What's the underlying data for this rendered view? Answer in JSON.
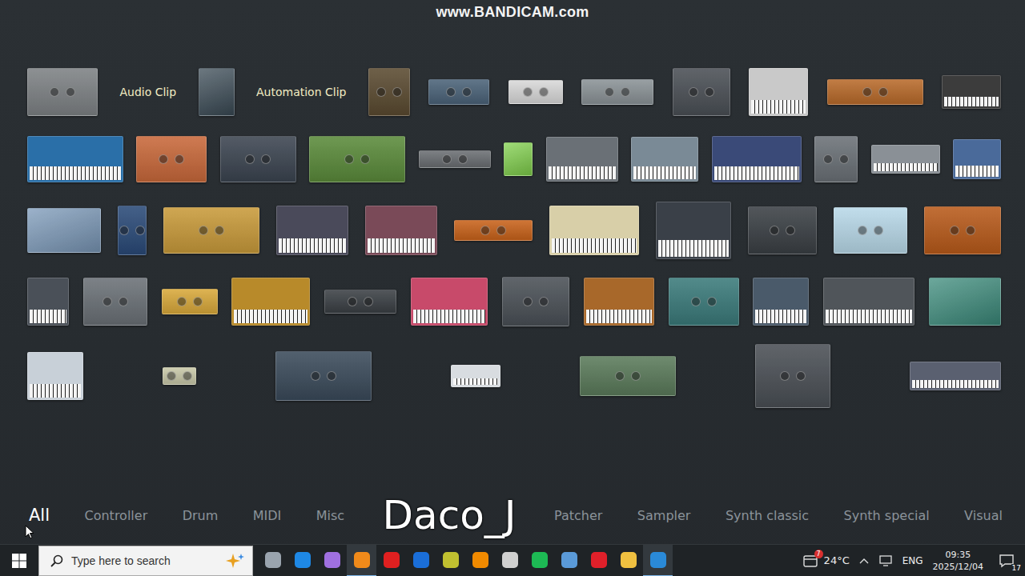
{
  "watermark": "www.BANDICAM.com",
  "caption": "Daco_J",
  "picker": {
    "rows": [
      [
        {
          "kind": "panel",
          "color": "#7d8184"
        },
        {
          "kind": "label",
          "text": "Audio Clip"
        },
        {
          "kind": "photo",
          "color": "#3a4a55"
        },
        {
          "kind": "label",
          "text": "Automation Clip"
        },
        {
          "kind": "panel",
          "color": "#5a4a30"
        },
        {
          "kind": "panel",
          "color": "#4a6278"
        },
        {
          "kind": "panel",
          "color": "#d8d8d8"
        },
        {
          "kind": "panel",
          "color": "#8a9296"
        },
        {
          "kind": "panel",
          "color": "#4a4f55"
        },
        {
          "kind": "keys",
          "color": "#c9c9c9"
        },
        {
          "kind": "panel",
          "color": "#b86a2a"
        },
        {
          "kind": "keys",
          "color": "#3c3c3c"
        }
      ],
      [
        {
          "kind": "keys",
          "color": "#2a6fa8"
        },
        {
          "kind": "panel",
          "color": "#c8683a"
        },
        {
          "kind": "panel",
          "color": "#3b4450"
        },
        {
          "kind": "panel",
          "color": "#5a8a3a"
        },
        {
          "kind": "panel",
          "color": "#6a6e72"
        },
        {
          "kind": "photo",
          "color": "#7fd04a"
        },
        {
          "kind": "keys",
          "color": "#6a7076"
        },
        {
          "kind": "keys",
          "color": "#7a8a96"
        },
        {
          "kind": "keys",
          "color": "#3a4a78"
        },
        {
          "kind": "panel",
          "color": "#6a7076"
        },
        {
          "kind": "keys",
          "color": "#8a9096"
        },
        {
          "kind": "keys",
          "color": "#4a6a9a"
        }
      ],
      [
        {
          "kind": "photo",
          "color": "#7a98b8"
        },
        {
          "kind": "panel",
          "color": "#2a4a78"
        },
        {
          "kind": "panel",
          "color": "#c89a3a"
        },
        {
          "kind": "keys",
          "color": "#4a4a5a"
        },
        {
          "kind": "keys",
          "color": "#7a4a58"
        },
        {
          "kind": "panel",
          "color": "#c8621a"
        },
        {
          "kind": "keys",
          "color": "#d8cfa8"
        },
        {
          "kind": "keys",
          "color": "#3a4048"
        },
        {
          "kind": "panel",
          "color": "#3a3f44"
        },
        {
          "kind": "panel",
          "color": "#b8d8e8"
        },
        {
          "kind": "panel",
          "color": "#b85a1a"
        }
      ],
      [
        {
          "kind": "keys",
          "color": "#4a5058"
        },
        {
          "kind": "panel",
          "color": "#6a7076"
        },
        {
          "kind": "panel",
          "color": "#d8a83a"
        },
        {
          "kind": "keys",
          "color": "#b88a2a"
        },
        {
          "kind": "panel",
          "color": "#3a3f44"
        },
        {
          "kind": "keys",
          "color": "#c84a6a"
        },
        {
          "kind": "panel",
          "color": "#4a5056"
        },
        {
          "kind": "keys",
          "color": "#a8682a"
        },
        {
          "kind": "panel",
          "color": "#3a7a7a"
        },
        {
          "kind": "keys",
          "color": "#4a5a6a"
        },
        {
          "kind": "keys",
          "color": "#50555a"
        },
        {
          "kind": "photo",
          "color": "#3a8a7a"
        }
      ],
      [
        {
          "kind": "keys",
          "color": "#c8d0d8"
        },
        {
          "kind": "panel",
          "color": "#c8c8a8"
        },
        {
          "kind": "panel",
          "color": "#3a4a5a"
        },
        {
          "kind": "keys",
          "color": "#d8dce0"
        },
        {
          "kind": "panel",
          "color": "#5a7a5a"
        },
        {
          "kind": "panel",
          "color": "#4a4f55"
        },
        {
          "kind": "keys",
          "color": "#5a6070"
        }
      ]
    ]
  },
  "tabs": [
    {
      "label": "All",
      "selected": true
    },
    {
      "label": "Controller",
      "selected": false
    },
    {
      "label": "Drum",
      "selected": false
    },
    {
      "label": "MIDI",
      "selected": false
    },
    {
      "label": "Misc",
      "selected": false
    },
    {
      "label": "Patcher",
      "selected": false
    },
    {
      "label": "Sampler",
      "selected": false
    },
    {
      "label": "Synth classic",
      "selected": false
    },
    {
      "label": "Synth special",
      "selected": false
    },
    {
      "label": "Visual",
      "selected": false
    }
  ],
  "taskbar": {
    "search": {
      "placeholder": "Type here to search"
    },
    "apps": [
      {
        "color": "#9aa4ae",
        "active": false
      },
      {
        "color": "#1e88e5",
        "active": false
      },
      {
        "color": "#a070e0",
        "active": false
      },
      {
        "color": "#f08a1a",
        "active": true
      },
      {
        "color": "#e02020",
        "active": false
      },
      {
        "color": "#1a6ed8",
        "active": false
      },
      {
        "color": "#c0c030",
        "active": false
      },
      {
        "color": "#f08a00",
        "active": false
      },
      {
        "color": "#d0d0d0",
        "active": false
      },
      {
        "color": "#1db954",
        "active": false
      },
      {
        "color": "#5a9ad8",
        "active": false
      },
      {
        "color": "#e0202a",
        "active": false
      },
      {
        "color": "#f0c040",
        "active": false
      },
      {
        "color": "#2a8ad8",
        "active": true
      }
    ],
    "weather": {
      "temp": "24°C",
      "badge": "7"
    },
    "language": "ENG",
    "time": "09:35",
    "date": "2025/12/04",
    "notifications": "17"
  }
}
